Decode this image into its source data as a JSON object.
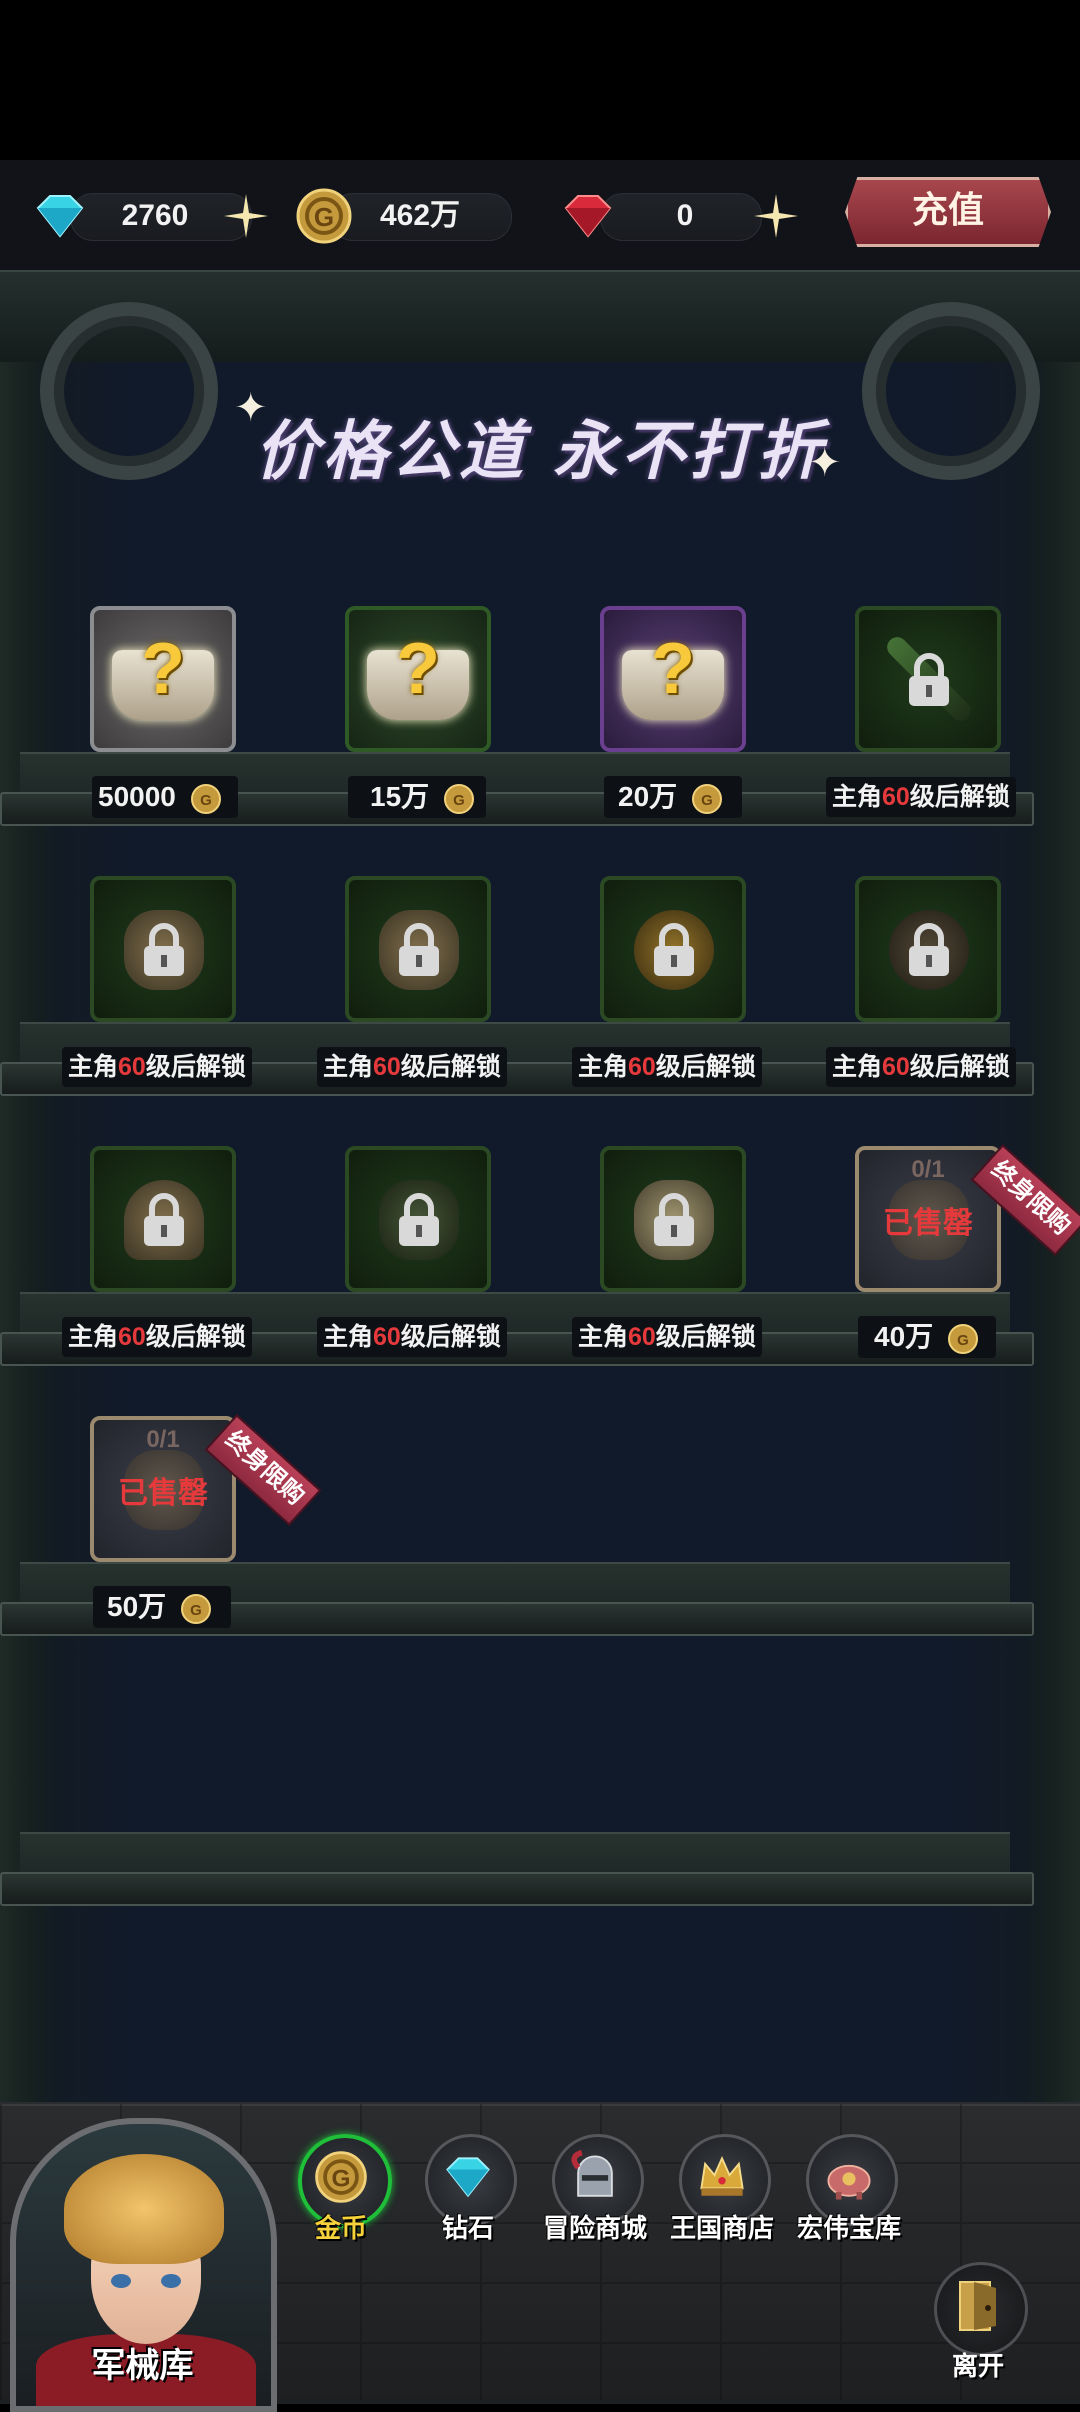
{
  "currency": {
    "diamond_value": "2760",
    "gold_value": "462万",
    "ruby_value": "0",
    "recharge_label": "充值"
  },
  "banner": {
    "slogan": "价格公道 永不打折"
  },
  "shop": {
    "row1": [
      {
        "price": "50000",
        "color": "grey"
      },
      {
        "price": "15万",
        "color": "green"
      },
      {
        "price": "20万",
        "color": "purple"
      },
      {
        "unlock_prefix": "主角",
        "unlock_level": "60",
        "unlock_suffix": "级后解锁"
      }
    ],
    "row2": [
      {
        "unlock_prefix": "主角",
        "unlock_level": "60",
        "unlock_suffix": "级后解锁"
      },
      {
        "unlock_prefix": "主角",
        "unlock_level": "60",
        "unlock_suffix": "级后解锁"
      },
      {
        "unlock_prefix": "主角",
        "unlock_level": "60",
        "unlock_suffix": "级后解锁"
      },
      {
        "unlock_prefix": "主角",
        "unlock_level": "60",
        "unlock_suffix": "级后解锁"
      }
    ],
    "row3": [
      {
        "unlock_prefix": "主角",
        "unlock_level": "60",
        "unlock_suffix": "级后解锁"
      },
      {
        "unlock_prefix": "主角",
        "unlock_level": "60",
        "unlock_suffix": "级后解锁"
      },
      {
        "unlock_prefix": "主角",
        "unlock_level": "60",
        "unlock_suffix": "级后解锁"
      },
      {
        "price": "40万",
        "ratio": "0/1",
        "status": "已售罄",
        "tag": "终身限购"
      }
    ],
    "row4": [
      {
        "price": "50万",
        "ratio": "0/1",
        "status": "已售罄",
        "tag": "终身限购"
      }
    ]
  },
  "nav": {
    "portrait_label": "军械库",
    "tabs": [
      "金币",
      "钻石",
      "冒险商城",
      "王国商店",
      "宏伟宝库"
    ],
    "active_tab": "金币",
    "leave_label": "离开"
  },
  "colors": {
    "accent_green": "#1fbf3a",
    "sold_red": "#e5393c",
    "recharge": "#8e2a38"
  },
  "icons": [
    "diamond-icon",
    "gold-coin-icon",
    "ruby-icon",
    "plus-icon",
    "lock-icon",
    "mystery-chest-icon",
    "exit-door-icon"
  ]
}
